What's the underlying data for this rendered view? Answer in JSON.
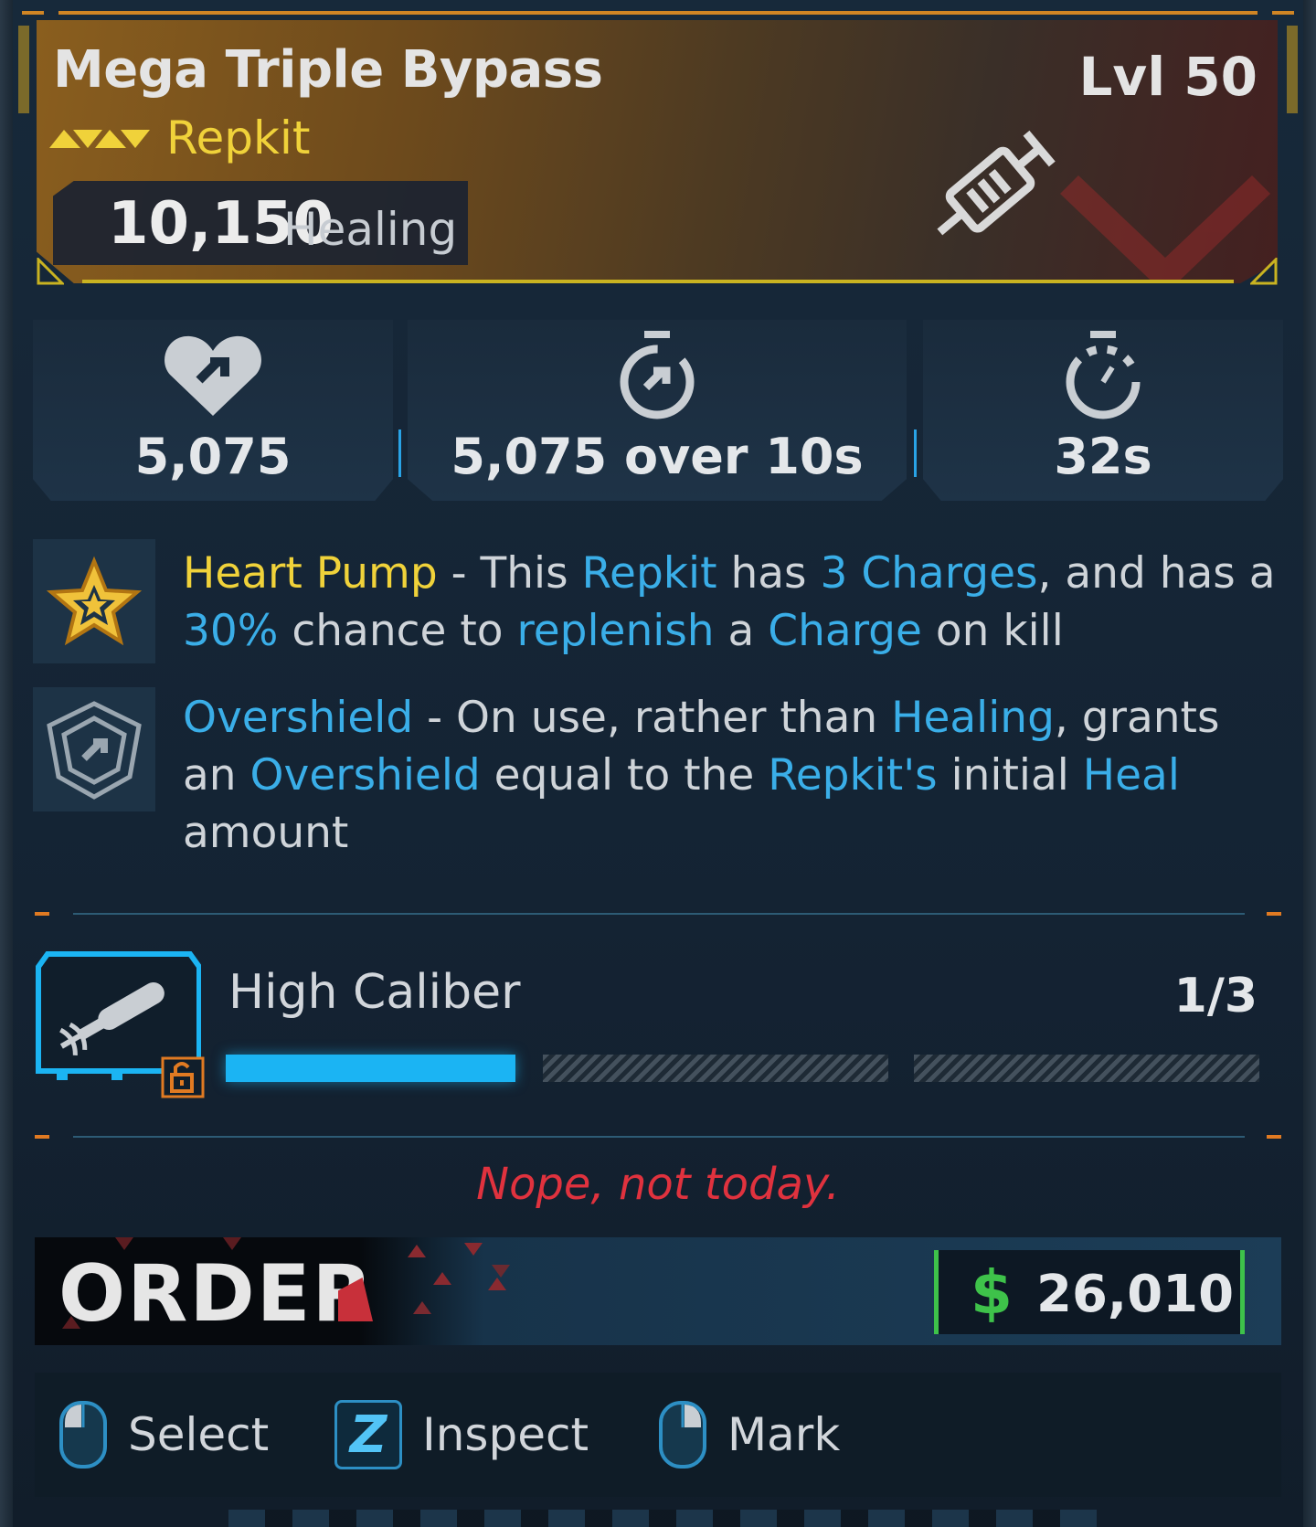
{
  "item": {
    "name": "Mega Triple Bypass",
    "level": "Lvl 50",
    "rarity_icon": "rarity-chevrons-icon",
    "type": "Repkit",
    "healing_value": "10,150",
    "healing_label": "Healing",
    "type_icon": "syringe-icon"
  },
  "stats": [
    {
      "icon": "heart-plus-icon",
      "value": "5,075"
    },
    {
      "icon": "timer-heal-icon",
      "value": "5,075 over 10s"
    },
    {
      "icon": "stopwatch-icon",
      "value": "32s"
    }
  ],
  "perks": [
    {
      "icon": "gold-star-icon",
      "name": "Heart Pump",
      "t1": " - This ",
      "k1": "Repkit",
      "t2": " has ",
      "k2": "3 Charges",
      "t3": ", and has a ",
      "k3": "30%",
      "t4": " chance to ",
      "k4": "replenish",
      "t5": " a ",
      "k5": "Charge",
      "t6": " on kill"
    },
    {
      "icon": "shield-plus-icon",
      "name": "Overshield",
      "t1": " - On use, rather than ",
      "k1": "Healing",
      "t2": ", grants an ",
      "k2": "Overshield",
      "t3": " equal to the ",
      "k3": "Repkit's",
      "t4": " initial ",
      "k4": "Heal",
      "t5": " amount"
    }
  ],
  "mod": {
    "icon": "bullet-syringe-icon",
    "lock_icon": "unlock-icon",
    "name": "High Caliber",
    "count": "1/3",
    "progress": 0.333
  },
  "flavor_text": "Nope, not today.",
  "manufacturer": {
    "logo_text": "ORDER",
    "logo_icon": "order-logo"
  },
  "price": {
    "currency_icon": "dollar-icon",
    "value": "26,010"
  },
  "actions": [
    {
      "icon": "mouse-left-icon",
      "label": "Select"
    },
    {
      "icon": "z-key-icon",
      "key": "Z",
      "label": "Inspect"
    },
    {
      "icon": "mouse-right-icon",
      "label": "Mark"
    }
  ],
  "colors": {
    "accent_blue": "#3aaee8",
    "rarity_yellow": "#f0d23a",
    "flavor_red": "#e0323e",
    "price_green": "#3ec24a",
    "orange": "#d08524"
  }
}
